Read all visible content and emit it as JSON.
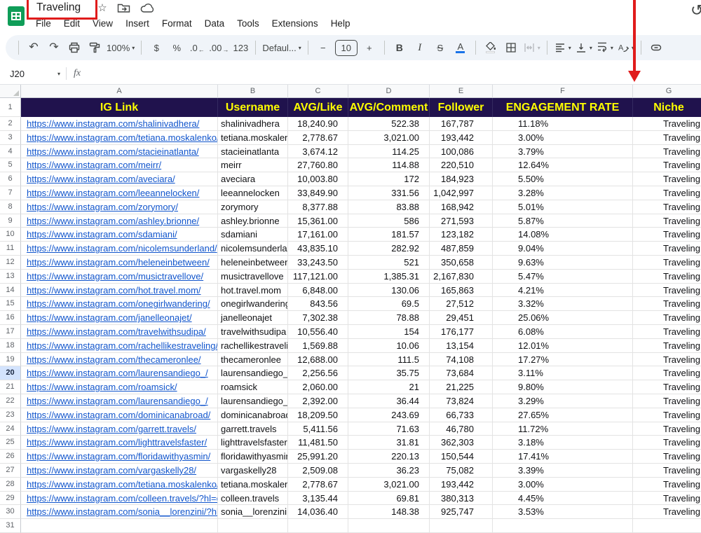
{
  "app": {
    "title": "Traveling",
    "menu": [
      "File",
      "Edit",
      "View",
      "Insert",
      "Format",
      "Data",
      "Tools",
      "Extensions",
      "Help"
    ]
  },
  "toolbar": {
    "zoom": "100%",
    "currency": "$",
    "percent": "%",
    "decrease_decimal": ".0",
    "increase_decimal": ".00",
    "more_formats": "123",
    "font": "Defaul...",
    "font_size": "10",
    "decrease_font": "−",
    "increase_font": "+",
    "bold": "B",
    "italic": "I",
    "strikethrough": "S",
    "text_color": "A"
  },
  "formula_bar": {
    "name_box": "J20",
    "fx": "fx"
  },
  "grid": {
    "column_letters": [
      "A",
      "B",
      "C",
      "D",
      "E",
      "F",
      "G"
    ],
    "header_cells": [
      "IG Link",
      "Username",
      "AVG/Like",
      "AVG/Comment",
      "Follower",
      "ENGAGEMENT RATE",
      "Niche"
    ],
    "selected_row": "20",
    "partial_row_number": "31",
    "rows": [
      {
        "n": "2",
        "link": "https://www.instagram.com/shalinivadhera/",
        "username": "shalinivadhera",
        "avg_like": "18,240.90",
        "avg_comment": "522.38",
        "follower": "167,787",
        "engagement": "11.18%",
        "niche": "Traveling"
      },
      {
        "n": "3",
        "link": "https://www.instagram.com/tetiana.moskalenko/",
        "username": "tetiana.moskalenko",
        "avg_like": "2,778.67",
        "avg_comment": "3,021.00",
        "follower": "193,442",
        "engagement": "3.00%",
        "niche": "Traveling"
      },
      {
        "n": "4",
        "link": "https://www.instagram.com/stacieinatlanta/",
        "username": "stacieinatlanta",
        "avg_like": "3,674.12",
        "avg_comment": "114.25",
        "follower": "100,086",
        "engagement": "3.79%",
        "niche": "Traveling"
      },
      {
        "n": "5",
        "link": "https://www.instagram.com/meirr/",
        "username": "meirr",
        "avg_like": "27,760.80",
        "avg_comment": "114.88",
        "follower": "220,510",
        "engagement": "12.64%",
        "niche": "Traveling"
      },
      {
        "n": "6",
        "link": "https://www.instagram.com/aveciara/",
        "username": "aveciara",
        "avg_like": "10,003.80",
        "avg_comment": "172",
        "follower": "184,923",
        "engagement": "5.50%",
        "niche": "Traveling"
      },
      {
        "n": "7",
        "link": "https://www.instagram.com/leeannelocken/",
        "username": "leeannelocken",
        "avg_like": "33,849.90",
        "avg_comment": "331.56",
        "follower": "1,042,997",
        "engagement": "3.28%",
        "niche": "Traveling"
      },
      {
        "n": "8",
        "link": "https://www.instagram.com/zorymory/",
        "username": "zorymory",
        "avg_like": "8,377.88",
        "avg_comment": "83.88",
        "follower": "168,942",
        "engagement": "5.01%",
        "niche": "Traveling"
      },
      {
        "n": "9",
        "link": "https://www.instagram.com/ashley.brionne/",
        "username": "ashley.brionne",
        "avg_like": "15,361.00",
        "avg_comment": "586",
        "follower": "271,593",
        "engagement": "5.87%",
        "niche": "Traveling"
      },
      {
        "n": "10",
        "link": "https://www.instagram.com/sdamiani/",
        "username": "sdamiani",
        "avg_like": "17,161.00",
        "avg_comment": "181.57",
        "follower": "123,182",
        "engagement": "14.08%",
        "niche": "Traveling"
      },
      {
        "n": "11",
        "link": "https://www.instagram.com/nicolemsunderland/",
        "username": "nicolemsunderland",
        "avg_like": "43,835.10",
        "avg_comment": "282.92",
        "follower": "487,859",
        "engagement": "9.04%",
        "niche": "Traveling"
      },
      {
        "n": "12",
        "link": "https://www.instagram.com/heleneinbetween/",
        "username": "heleneinbetween",
        "avg_like": "33,243.50",
        "avg_comment": "521",
        "follower": "350,658",
        "engagement": "9.63%",
        "niche": "Traveling"
      },
      {
        "n": "13",
        "link": "https://www.instagram.com/musictravellove/",
        "username": "musictravellove",
        "avg_like": "117,121.00",
        "avg_comment": "1,385.31",
        "follower": "2,167,830",
        "engagement": "5.47%",
        "niche": "Traveling"
      },
      {
        "n": "14",
        "link": "https://www.instagram.com/hot.travel.mom/",
        "username": "hot.travel.mom",
        "avg_like": "6,848.00",
        "avg_comment": "130.06",
        "follower": "165,863",
        "engagement": "4.21%",
        "niche": "Traveling"
      },
      {
        "n": "15",
        "link": "https://www.instagram.com/onegirlwandering/",
        "username": "onegirlwandering",
        "avg_like": "843.56",
        "avg_comment": "69.5",
        "follower": "27,512",
        "engagement": "3.32%",
        "niche": "Traveling"
      },
      {
        "n": "16",
        "link": "https://www.instagram.com/janelleonajet/",
        "username": "janelleonajet",
        "avg_like": "7,302.38",
        "avg_comment": "78.88",
        "follower": "29,451",
        "engagement": "25.06%",
        "niche": "Traveling"
      },
      {
        "n": "17",
        "link": "https://www.instagram.com/travelwithsudipa/",
        "username": "travelwithsudipa",
        "avg_like": "10,556.40",
        "avg_comment": "154",
        "follower": "176,177",
        "engagement": "6.08%",
        "niche": "Traveling"
      },
      {
        "n": "18",
        "link": "https://www.instagram.com/rachellikestraveling/",
        "username": "rachellikestraveling",
        "avg_like": "1,569.88",
        "avg_comment": "10.06",
        "follower": "13,154",
        "engagement": "12.01%",
        "niche": "Traveling"
      },
      {
        "n": "19",
        "link": "https://www.instagram.com/thecameronlee/",
        "username": "thecameronlee",
        "avg_like": "12,688.00",
        "avg_comment": "111.5",
        "follower": "74,108",
        "engagement": "17.27%",
        "niche": "Traveling"
      },
      {
        "n": "20",
        "link": "https://www.instagram.com/laurensandiego_/",
        "username": "laurensandiego_",
        "avg_like": "2,256.56",
        "avg_comment": "35.75",
        "follower": "73,684",
        "engagement": "3.11%",
        "niche": "Traveling"
      },
      {
        "n": "21",
        "link": "https://www.instagram.com/roamsick/",
        "username": "roamsick",
        "avg_like": "2,060.00",
        "avg_comment": "21",
        "follower": "21,225",
        "engagement": "9.80%",
        "niche": "Traveling"
      },
      {
        "n": "22",
        "link": "https://www.instagram.com/laurensandiego_/",
        "username": "laurensandiego_",
        "avg_like": "2,392.00",
        "avg_comment": "36.44",
        "follower": "73,824",
        "engagement": "3.29%",
        "niche": "Traveling"
      },
      {
        "n": "23",
        "link": "https://www.instagram.com/dominicanabroad/",
        "username": "dominicanabroad",
        "avg_like": "18,209.50",
        "avg_comment": "243.69",
        "follower": "66,733",
        "engagement": "27.65%",
        "niche": "Traveling"
      },
      {
        "n": "24",
        "link": "https://www.instagram.com/garrett.travels/",
        "username": "garrett.travels",
        "avg_like": "5,411.56",
        "avg_comment": "71.63",
        "follower": "46,780",
        "engagement": "11.72%",
        "niche": "Traveling"
      },
      {
        "n": "25",
        "link": "https://www.instagram.com/lighttravelsfaster/",
        "username": "lighttravelsfaster",
        "avg_like": "11,481.50",
        "avg_comment": "31.81",
        "follower": "362,303",
        "engagement": "3.18%",
        "niche": "Traveling"
      },
      {
        "n": "26",
        "link": "https://www.instagram.com/floridawithyasmin/",
        "username": "floridawithyasmin",
        "avg_like": "25,991.20",
        "avg_comment": "220.13",
        "follower": "150,544",
        "engagement": "17.41%",
        "niche": "Traveling"
      },
      {
        "n": "27",
        "link": "https://www.instagram.com/vargaskelly28/",
        "username": "vargaskelly28",
        "avg_like": "2,509.08",
        "avg_comment": "36.23",
        "follower": "75,082",
        "engagement": "3.39%",
        "niche": "Traveling"
      },
      {
        "n": "28",
        "link": "https://www.instagram.com/tetiana.moskalenko/",
        "username": "tetiana.moskalenko",
        "avg_like": "2,778.67",
        "avg_comment": "3,021.00",
        "follower": "193,442",
        "engagement": "3.00%",
        "niche": "Traveling"
      },
      {
        "n": "29",
        "link": "https://www.instagram.com/colleen.travels/?hl=en",
        "username": "colleen.travels",
        "avg_like": "3,135.44",
        "avg_comment": "69.81",
        "follower": "380,313",
        "engagement": "4.45%",
        "niche": "Traveling"
      },
      {
        "n": "30",
        "link": "https://www.instagram.com/sonia__lorenzini/?hl=en",
        "username": "sonia__lorenzini",
        "avg_like": "14,036.40",
        "avg_comment": "148.38",
        "follower": "925,747",
        "engagement": "3.53%",
        "niche": "Traveling"
      }
    ]
  },
  "icons": {
    "chevron_down": "▾",
    "undo": "↶",
    "redo": "↷",
    "star": "☆",
    "history": "↺",
    "decrease_decimal_arrow": "←",
    "increase_decimal_arrow": "→"
  },
  "colors": {
    "header_bg": "#20124d",
    "header_fg": "#ffff00",
    "link": "#1155cc",
    "selected_row_bg": "#d3e3fd",
    "toolbar_bg": "#f0f4f9",
    "annotation": "#e01b1b"
  }
}
